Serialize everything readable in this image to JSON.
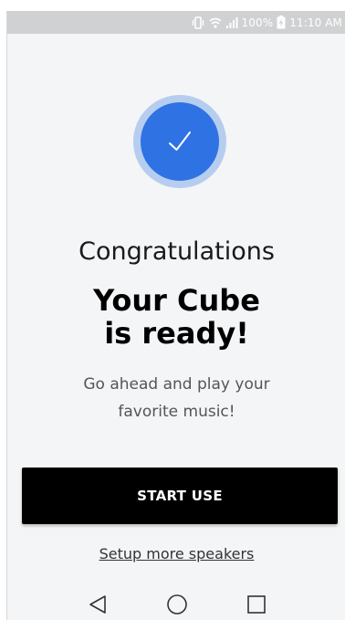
{
  "status_bar": {
    "battery_percent": "100%",
    "time": "11:10 AM",
    "icons": [
      "vibrate-icon",
      "wifi-icon",
      "signal-icon",
      "battery-charging-icon"
    ]
  },
  "success_icon": "checkmark-icon",
  "colors": {
    "accent": "#2f72e3",
    "accent_ring": "#b7cdef",
    "button_bg": "#000000",
    "background": "#f4f5f6"
  },
  "content": {
    "congrats": "Congratulations",
    "headline_line1": "Your Cube",
    "headline_line2": "is ready!",
    "subtitle_line1": "Go ahead and play your",
    "subtitle_line2": "favorite music!"
  },
  "actions": {
    "start_label": "START USE",
    "setup_link": "Setup more speakers"
  },
  "nav": {
    "back": "back-icon",
    "home": "home-icon",
    "recents": "recents-icon"
  }
}
